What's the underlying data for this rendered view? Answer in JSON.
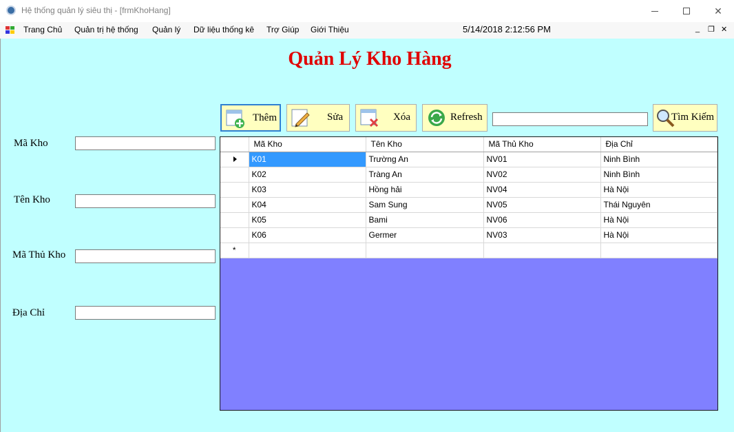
{
  "window": {
    "title": "Hệ thống quản lý siêu thị - [frmKhoHang]",
    "minimize_glyph": "",
    "close_glyph": "✕"
  },
  "menu": {
    "items": [
      "Trang Chủ",
      "Quản trị hệ thống",
      "Quản lý",
      "Dữ liệu thống kê",
      "Trợ Giúp",
      "Giới Thiệu"
    ],
    "clock": "5/14/2018 2:12:56 PM",
    "mdi_min": "_",
    "mdi_restore": "❐",
    "mdi_close": "✕"
  },
  "page": {
    "title": "Quản Lý Kho Hàng"
  },
  "form": {
    "ma_kho_label": "Mã Kho",
    "ten_kho_label": "Tên Kho",
    "ma_thu_kho_label": "Mã Thủ Kho",
    "dia_chi_label": "Địa Chỉ",
    "ma_kho_value": "",
    "ten_kho_value": "",
    "ma_thu_kho_value": "",
    "dia_chi_value": ""
  },
  "toolbar": {
    "add_label": "Thêm",
    "edit_label": "Sửa",
    "delete_label": "Xóa",
    "refresh_label": "Refresh",
    "search_label": "Tìm Kiếm",
    "search_value": ""
  },
  "grid": {
    "columns": [
      "Mã Kho",
      "Tên Kho",
      "Mã Thủ Kho",
      "Địa Chỉ"
    ],
    "rows": [
      [
        "K01",
        "Trường An",
        "NV01",
        "Ninh Bình"
      ],
      [
        "K02",
        "Tràng An",
        "NV02",
        "Ninh Bình"
      ],
      [
        "K03",
        "Hồng hải",
        "NV04",
        "Hà Nội"
      ],
      [
        "K04",
        "Sam Sung",
        "NV05",
        "Thái Nguyên"
      ],
      [
        "K05",
        "Bami",
        "NV06",
        "Hà Nội"
      ],
      [
        "K06",
        "Germer",
        "NV03",
        "Hà Nội"
      ]
    ],
    "new_row_marker": "*",
    "colors": {
      "background": "#8080ff",
      "selection": "#3399ff"
    }
  },
  "colors": {
    "form_background": "#c0ffff",
    "title": "#e00000",
    "button_background": "#ffffc0"
  }
}
